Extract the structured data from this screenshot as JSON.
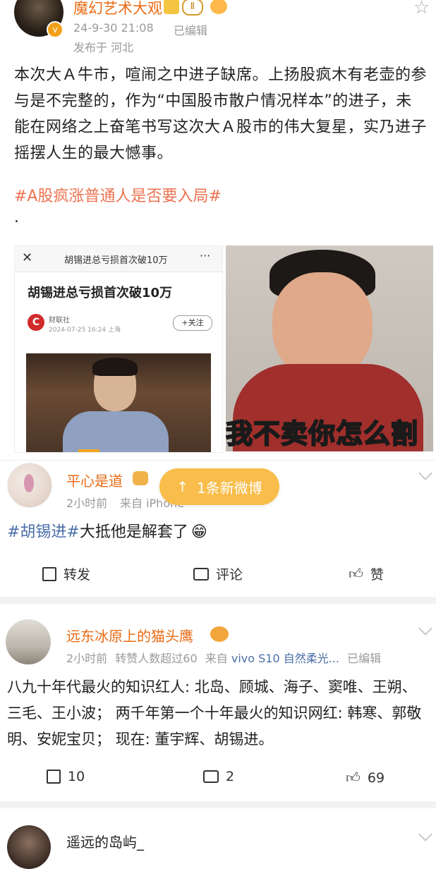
{
  "post1": {
    "author": "魔幻艺术大观",
    "level_badge": "Ⅱ",
    "time": "24-9-30 21:08",
    "edited": "已编辑",
    "location": "发布于 河北",
    "body": "本次大Ａ牛市，喧闹之中进子缺席。上扬股疯木有老壶的参与是不完整的，作为“中国股市散户情况样本”的进子，未能在网络之上奋笔书写这次大Ａ股市的伟大复星，实乃进子摇摆人生的最大憾事。",
    "hashtag": "#A股疯涨普通人是否要入局#",
    "dot": ".",
    "image1": {
      "header_title": "胡锡进总亏损首次破10万",
      "article_title": "胡锡进总亏损首次破10万",
      "source": "财联社",
      "source_time": "2024-07-25 16:24 上海",
      "follow": "+关注"
    },
    "image2": {
      "caption": "我不卖你怎么割"
    }
  },
  "new_posts_pill": "1条新微博",
  "comment1": {
    "author": "平心是道",
    "time": "2小时前",
    "source": "来自 iPhone",
    "hashtag": "#胡锡进#",
    "text": "大抵他是解套了",
    "emoji": "😁",
    "repost": "转发",
    "comment": "评论",
    "like": "赞"
  },
  "comment2": {
    "author": "远东冰原上的猫头鹰",
    "time": "2小时前",
    "meta": "转赞人数超过60",
    "source_prefix": "来自",
    "source": "vivo S10 自然柔光...",
    "edited": "已编辑",
    "text": "八九十年代最火的知识红人: 北岛、顾城、海子、窦唯、王朔、三毛、王小波； 两千年第一个十年最火的知识网红: 韩寒、郭敬明、安妮宝贝； 现在: 董宇辉、胡锡进。",
    "reposts": "10",
    "comments": "2",
    "likes": "69"
  },
  "comment3": {
    "author": "遥远的岛屿_"
  }
}
